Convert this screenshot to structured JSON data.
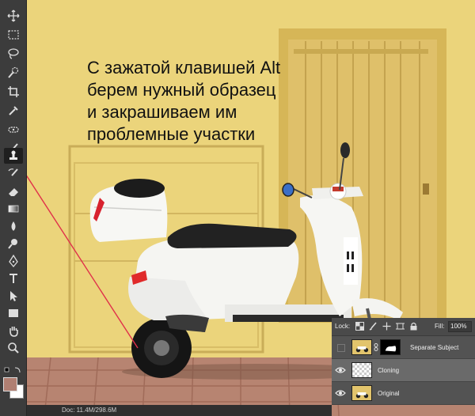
{
  "caption": {
    "line1": "С зажатой клавишей Alt",
    "line2": "берем нужный образец",
    "line3": "и закрашиваем им",
    "line4": "проблемные участки"
  },
  "toolbar": {
    "tools": [
      "move-tool",
      "marquee-tool",
      "lasso-tool",
      "quick-selection-tool",
      "crop-tool",
      "eyedropper-tool",
      "healing-brush-tool",
      "brush-tool",
      "clone-stamp-tool",
      "history-brush-tool",
      "eraser-tool",
      "gradient-tool",
      "blur-tool",
      "dodge-tool",
      "pen-tool",
      "type-tool",
      "path-selection-tool",
      "rectangle-tool",
      "hand-tool",
      "zoom-tool"
    ],
    "active_tool": "clone-stamp-tool",
    "foreground_color": "#b07f72",
    "background_color": "#ffffff"
  },
  "layers_panel": {
    "lock_label": "Lock:",
    "fill_label": "Fill:",
    "fill_value": "100%",
    "layers": [
      {
        "name": "Separate Subject",
        "visible": false,
        "selected": false
      },
      {
        "name": "Cloning",
        "visible": true,
        "selected": true
      },
      {
        "name": "Original",
        "visible": true,
        "selected": false
      }
    ]
  },
  "status_bar": {
    "text": "Doc: 11.4M/298.6M"
  },
  "colors": {
    "wall": "#e9cf74",
    "door": "#dfc06a",
    "annotation_line": "#e0304a"
  }
}
